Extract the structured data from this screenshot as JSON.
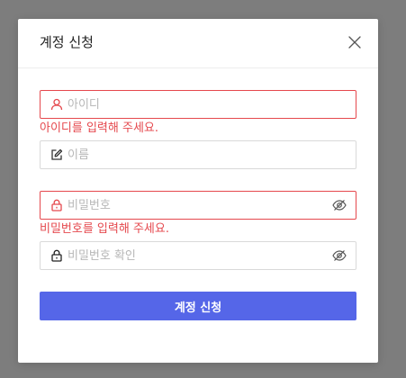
{
  "modal": {
    "title": "계정 신청",
    "close_icon": "close-icon"
  },
  "form": {
    "username": {
      "placeholder": "아이디",
      "value": "",
      "icon": "user-icon",
      "error": "아이디를 입력해 주세요."
    },
    "name": {
      "placeholder": "이름",
      "value": "",
      "icon": "edit-icon"
    },
    "password": {
      "placeholder": "비밀번호",
      "value": "",
      "icon": "lock-icon",
      "visibility_icon": "eye-off-icon",
      "error": "비밀번호를 입력해 주세요."
    },
    "password_confirm": {
      "placeholder": "비밀번호 확인",
      "value": "",
      "icon": "lock-icon",
      "visibility_icon": "eye-off-icon"
    },
    "submit_label": "계정 신청"
  },
  "colors": {
    "primary": "#5566e8",
    "error": "#e5484d",
    "border": "#d9d9d9",
    "placeholder": "#b7b7b7",
    "overlay": "#7d7d7d"
  }
}
